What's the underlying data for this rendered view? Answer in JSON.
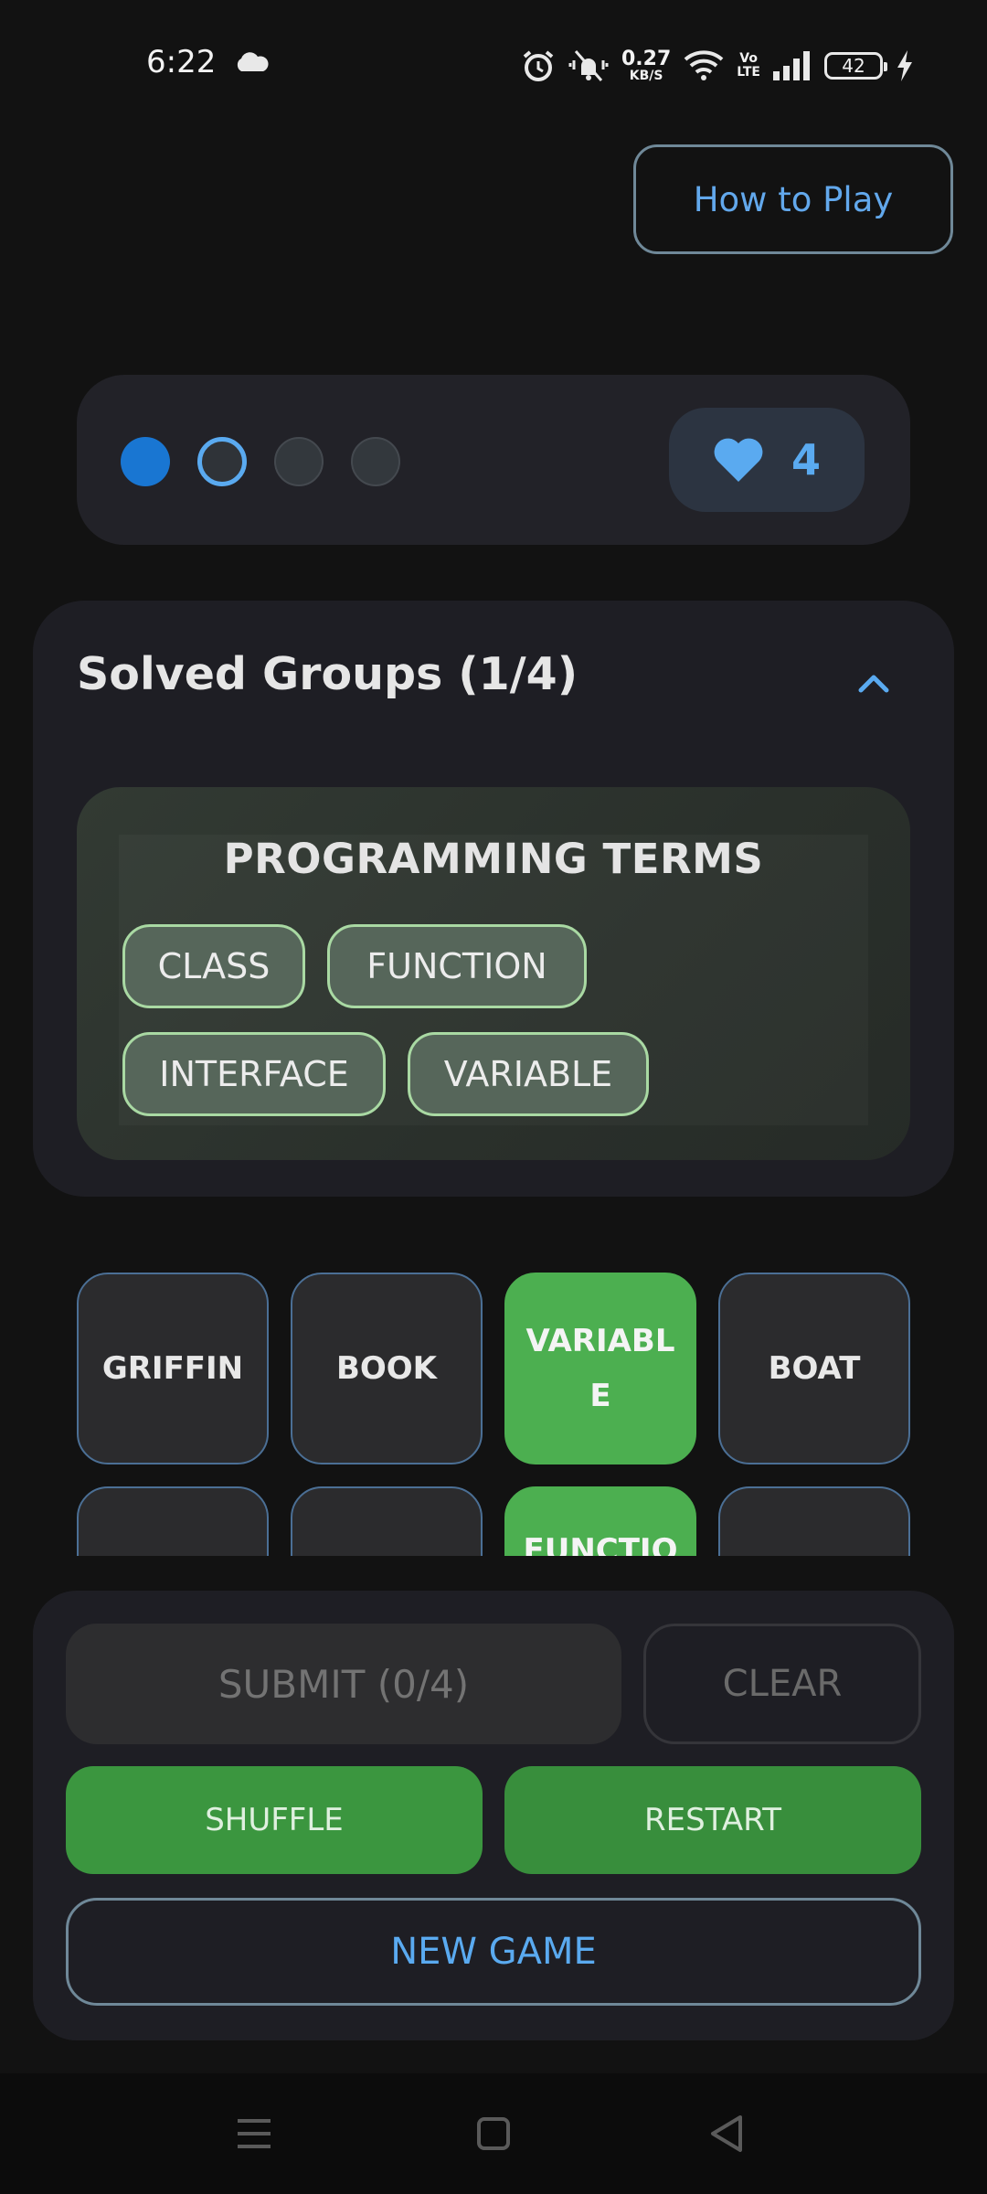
{
  "status_bar": {
    "time": "6:22",
    "net_speed_value": "0.27",
    "net_speed_unit": "KB/S",
    "volte_top": "Vo",
    "volte_bottom": "LTE",
    "battery": "42",
    "icons": [
      "cloud-icon",
      "alarm-icon",
      "vibrate-off-icon",
      "wifi-icon",
      "signal-icon",
      "battery-icon",
      "charging-bolt-icon"
    ]
  },
  "header": {
    "how_to_play_label": "How to Play"
  },
  "progress": {
    "groups_total": 4,
    "groups_solved": 1,
    "lives": "4",
    "colors": {
      "solved": "#1976d2",
      "current": "#5aaaf0",
      "pending": "#33383d"
    }
  },
  "solved_section": {
    "title": "Solved Groups (1/4)",
    "groups": [
      {
        "name": "PROGRAMMING TERMS",
        "words": [
          "CLASS",
          "FUNCTION",
          "INTERFACE",
          "VARIABLE"
        ]
      }
    ]
  },
  "grid": {
    "tiles": [
      {
        "label": "GRIFFIN",
        "selected": false
      },
      {
        "label": "BOOK",
        "selected": false
      },
      {
        "label": "VARIABL\nE",
        "selected": true
      },
      {
        "label": "BOAT",
        "selected": false
      },
      {
        "label": "",
        "selected": false
      },
      {
        "label": "",
        "selected": false
      },
      {
        "label": "FUNCTIO",
        "selected": true
      },
      {
        "label": "",
        "selected": false
      }
    ]
  },
  "controls": {
    "submit_label": "SUBMIT (0/4)",
    "clear_label": "CLEAR",
    "shuffle_label": "SHUFFLE",
    "restart_label": "RESTART",
    "new_game_label": "NEW GAME"
  },
  "theme": {
    "background": "#121212",
    "card": "#1e1e24",
    "accent_blue": "#5aaaf0",
    "accent_green": "#4caf50"
  }
}
